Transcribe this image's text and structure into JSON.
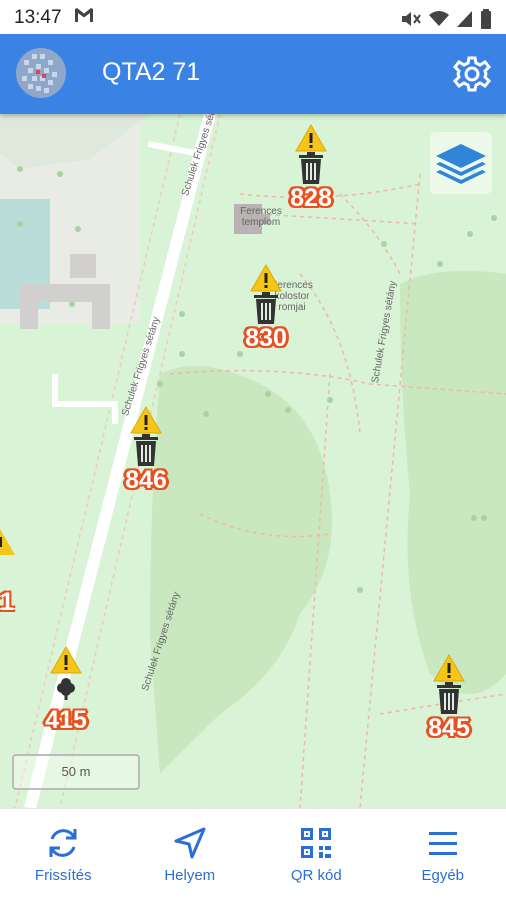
{
  "status_bar": {
    "time": "13:47",
    "mail_icon": "gmail-icon",
    "icons": [
      "mute-icon",
      "wifi-icon",
      "signal-icon",
      "battery-icon"
    ]
  },
  "app_bar": {
    "title": "QTA2 71",
    "logo_icon": "app-logo-icon",
    "settings_icon": "gear-icon",
    "color": "#3a82e4"
  },
  "map": {
    "street_labels": [
      "Schulek Frigyes sétány",
      "Schulek Frigyes sétány",
      "Schulek Frigyes sétány",
      "Schulek Frigyes sétány"
    ],
    "poi_labels": [
      "Ferences templom",
      "Ferences kolostor romjai"
    ],
    "scale_label": "50 m",
    "layers_icon": "layers-icon",
    "markers": [
      {
        "id": "828",
        "label": "828",
        "icon": "trash-icon",
        "warning": true
      },
      {
        "id": "830",
        "label": "830",
        "icon": "trash-icon",
        "warning": true
      },
      {
        "id": "846",
        "label": "846",
        "icon": "trash-icon",
        "warning": true
      },
      {
        "id": "415",
        "label": "415",
        "icon": "tree-icon",
        "warning": true
      },
      {
        "id": "845",
        "label": "845",
        "icon": "trash-icon",
        "warning": true
      },
      {
        "id": "partial",
        "label": "1",
        "icon": "tree-icon",
        "warning": true
      }
    ],
    "label_color": "#e8501f",
    "warning_color": "#f5c518"
  },
  "bottom_nav": {
    "items": [
      {
        "label": "Frissítés",
        "icon": "refresh-icon"
      },
      {
        "label": "Helyem",
        "icon": "location-arrow-icon"
      },
      {
        "label": "QR kód",
        "icon": "qr-code-icon"
      },
      {
        "label": "Egyéb",
        "icon": "menu-icon"
      }
    ],
    "color": "#2a6fd6"
  }
}
